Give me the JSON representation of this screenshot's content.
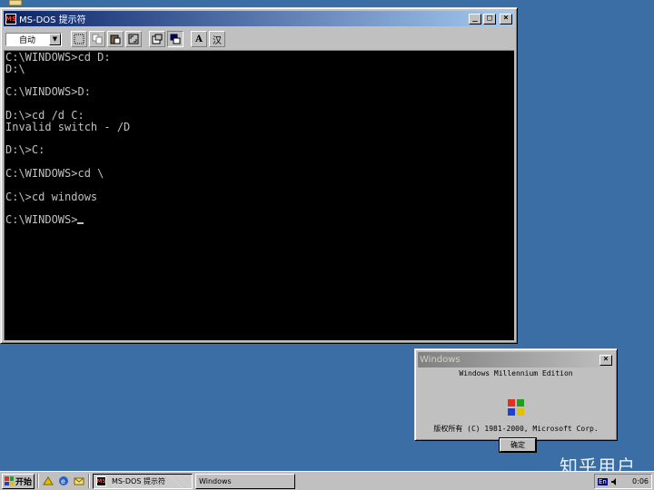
{
  "dos_window": {
    "title": "MS-DOS 提示符",
    "font_select": "自动",
    "console_lines": [
      "C:\\WINDOWS>cd D:",
      "D:\\",
      "",
      "C:\\WINDOWS>D:",
      "",
      "D:\\>cd /d C:",
      "Invalid switch - /D",
      "",
      "D:\\>C:",
      "",
      "C:\\WINDOWS>cd \\",
      "",
      "C:\\>cd windows",
      "",
      "C:\\WINDOWS>"
    ]
  },
  "about_dialog": {
    "title": "Windows",
    "product": "Windows Millennium Edition",
    "copyright": "版权所有 (C) 1981-2000, Microsoft Corp.",
    "ok_label": "确定"
  },
  "taskbar": {
    "start_label": "开始",
    "tasks": [
      {
        "label": "MS-DOS 提示符"
      },
      {
        "label": "Windows"
      }
    ],
    "lang": "En",
    "clock": "0:06"
  },
  "watermark": "知乎用户"
}
